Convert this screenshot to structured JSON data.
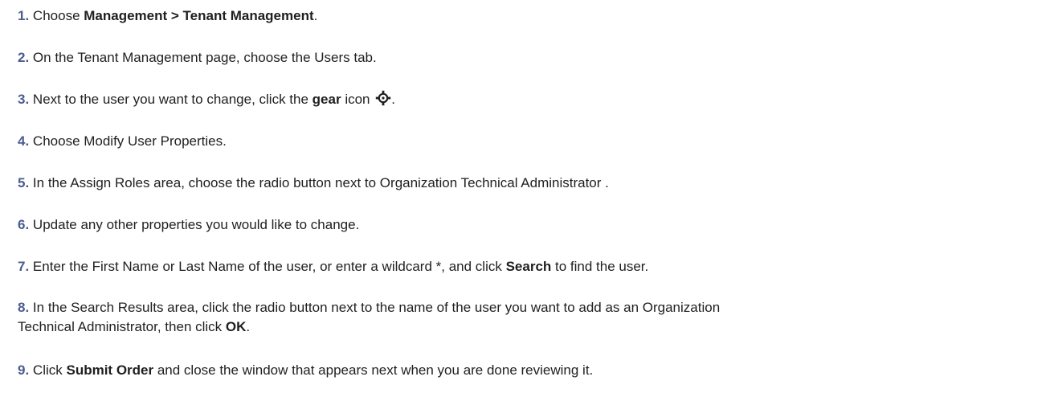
{
  "steps": [
    {
      "num": "1.",
      "parts": [
        "Choose ",
        "Management > Tenant Management",
        "."
      ]
    },
    {
      "num": "2.",
      "text": "On the Tenant Management page, choose the Users tab."
    },
    {
      "num": "3.",
      "parts": [
        "Next to the user you want to change, click the ",
        "gear",
        " icon ",
        "."
      ],
      "icon": "gear-icon"
    },
    {
      "num": "4.",
      "text": "Choose Modify User Properties."
    },
    {
      "num": "5.",
      "text": "In the Assign Roles area, choose the radio button next to Organization Technical Administrator ."
    },
    {
      "num": "6.",
      "text": "Update any other properties you would like to change."
    },
    {
      "num": "7.",
      "parts": [
        "Enter the First Name or Last Name of the user, or enter a wildcard *, and click ",
        "Search",
        " to find the user."
      ]
    },
    {
      "num": "8.",
      "parts": [
        "In the Search Results area, click the radio button next to the name of the user you want to add as an Organization",
        "Technical Administrator, then click ",
        "OK",
        "."
      ]
    },
    {
      "num": "9.",
      "parts": [
        "Click ",
        "Submit Order",
        " and close the window that appears next when you are done reviewing it."
      ]
    }
  ],
  "colors": {
    "number": "#4a5c8f",
    "text": "#1f1f1f"
  }
}
